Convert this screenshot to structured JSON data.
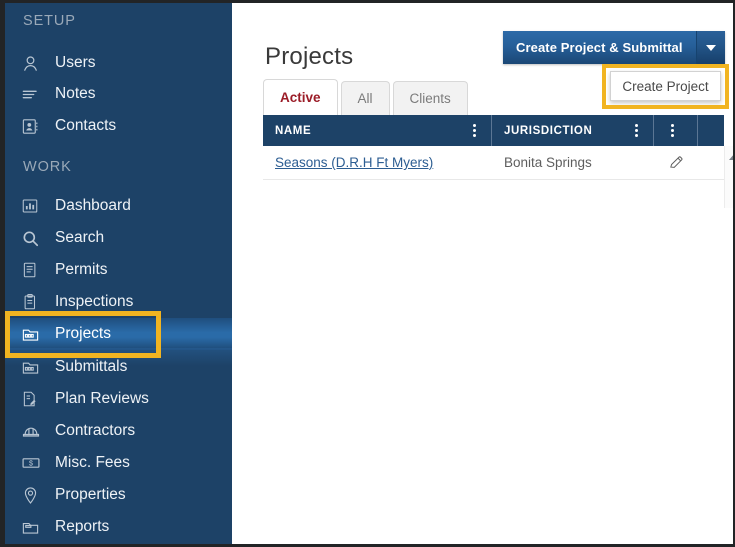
{
  "theme": {
    "sidebar_bg": "#1d4267",
    "accent_blue": "#2a6ba8",
    "annotation_yellow": "#f1b421",
    "active_tab_text": "#9b1c27",
    "link_blue": "#2c5d92",
    "active_nav_marker": "#b62a2a"
  },
  "sidebar": {
    "sections": [
      {
        "label": "SETUP"
      },
      {
        "label": "WORK"
      }
    ],
    "setup_items": [
      {
        "label": "Users",
        "icon": "user-icon"
      },
      {
        "label": "Notes",
        "icon": "notes-lines-icon"
      },
      {
        "label": "Contacts",
        "icon": "contact-card-icon"
      }
    ],
    "work_items": [
      {
        "label": "Dashboard",
        "icon": "bar-chart-icon",
        "active": false
      },
      {
        "label": "Search",
        "icon": "magnifier-icon",
        "active": false
      },
      {
        "label": "Permits",
        "icon": "document-icon",
        "active": false
      },
      {
        "label": "Inspections",
        "icon": "clipboard-icon",
        "active": false
      },
      {
        "label": "Projects",
        "icon": "folder-grid-icon",
        "active": true
      },
      {
        "label": "Submittals",
        "icon": "folder-grid-icon",
        "active": false
      },
      {
        "label": "Plan Reviews",
        "icon": "doc-pencil-icon",
        "active": false
      },
      {
        "label": "Contractors",
        "icon": "hard-hat-icon",
        "active": false
      },
      {
        "label": "Misc. Fees",
        "icon": "money-bill-icon",
        "active": false
      },
      {
        "label": "Properties",
        "icon": "map-pin-icon",
        "active": false
      },
      {
        "label": "Reports",
        "icon": "folder-open-icon",
        "active": false
      }
    ]
  },
  "main": {
    "page_title": "Projects",
    "create_button": {
      "label": "Create Project & Submittal",
      "caret_icon": "chevron-down-icon"
    },
    "dropdown": {
      "item_label": "Create Project",
      "highlighted": true
    },
    "tabs": [
      {
        "label": "Active",
        "active": true
      },
      {
        "label": "All",
        "active": false
      },
      {
        "label": "Clients",
        "active": false
      }
    ],
    "table": {
      "columns": [
        {
          "label": "NAME",
          "menu_icon": "kebab-menu-icon"
        },
        {
          "label": "JURISDICTION",
          "menu_icon": "kebab-menu-icon"
        },
        {
          "label": "",
          "menu_icon": "kebab-menu-icon"
        }
      ],
      "rows": [
        {
          "name": "Seasons (D.R.H Ft Myers)",
          "jurisdiction": "Bonita Springs",
          "edit_icon": "pencil-icon"
        }
      ]
    },
    "scrollbar": {
      "up_arrow_icon": "triangle-up-icon"
    }
  }
}
